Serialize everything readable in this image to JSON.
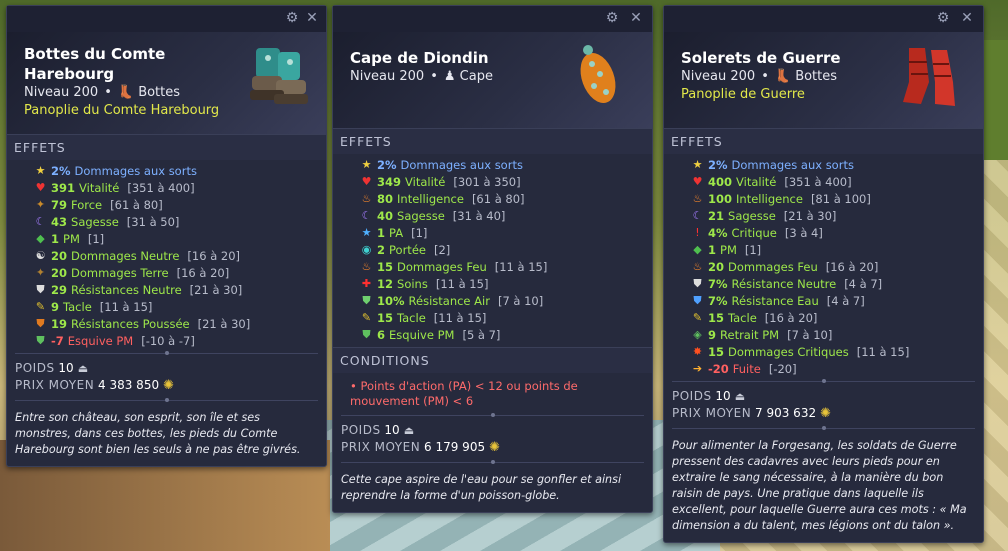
{
  "panels": [
    {
      "name": "Bottes du Comte Harebourg",
      "level": "Niveau 200",
      "type": "Bottes",
      "set": "Panoplie du Comte Harebourg",
      "effects_title": "EFFETS",
      "effects": [
        {
          "icon": "star-icon",
          "value": "2%",
          "label": "Dommages aux sorts",
          "range": "",
          "style": "blue"
        },
        {
          "icon": "heart-icon",
          "value": "391",
          "label": "Vitalité",
          "range": "[351 à 400]",
          "style": "green"
        },
        {
          "icon": "strength-icon",
          "value": "79",
          "label": "Force",
          "range": "[61 à 80]",
          "style": "green"
        },
        {
          "icon": "moon-icon",
          "value": "43",
          "label": "Sagesse",
          "range": "[31 à 50]",
          "style": "green"
        },
        {
          "icon": "pm-icon",
          "value": "1",
          "label": "PM",
          "range": "[1]",
          "style": "green"
        },
        {
          "icon": "neutral-icon",
          "value": "20",
          "label": "Dommages Neutre",
          "range": "[16 à 20]",
          "style": "green"
        },
        {
          "icon": "earth-icon",
          "value": "20",
          "label": "Dommages Terre",
          "range": "[16 à 20]",
          "style": "green"
        },
        {
          "icon": "shield-icon",
          "value": "29",
          "label": "Résistances Neutre",
          "range": "[21 à 30]",
          "style": "green"
        },
        {
          "icon": "tackle-icon",
          "value": "9",
          "label": "Tacle",
          "range": "[11 à 15]",
          "style": "green"
        },
        {
          "icon": "push-shield-icon",
          "value": "19",
          "label": "Résistances Poussée",
          "range": "[21 à 30]",
          "style": "green"
        },
        {
          "icon": "dodge-icon",
          "value": "-7",
          "label": "Esquive PM",
          "range": "[-10 à -7]",
          "style": "red"
        }
      ],
      "conditions": null,
      "weight_label": "POIDS",
      "weight": "10",
      "price_label": "PRIX MOYEN",
      "price": "4 383 850",
      "description": "Entre son château, son esprit, son île et ses monstres, dans ces bottes, les pieds du Comte Harebourg sont bien les seuls à ne pas être givrés."
    },
    {
      "name": "Cape de Diondin",
      "level": "Niveau 200",
      "type": "Cape",
      "set": "",
      "effects_title": "EFFETS",
      "effects": [
        {
          "icon": "star-icon",
          "value": "2%",
          "label": "Dommages aux sorts",
          "range": "",
          "style": "blue"
        },
        {
          "icon": "heart-icon",
          "value": "349",
          "label": "Vitalité",
          "range": "[301 à 350]",
          "style": "green"
        },
        {
          "icon": "fire-icon",
          "value": "80",
          "label": "Intelligence",
          "range": "[61 à 80]",
          "style": "green"
        },
        {
          "icon": "moon-icon",
          "value": "40",
          "label": "Sagesse",
          "range": "[31 à 40]",
          "style": "green"
        },
        {
          "icon": "pa-icon",
          "value": "1",
          "label": "PA",
          "range": "[1]",
          "style": "green"
        },
        {
          "icon": "range-icon",
          "value": "2",
          "label": "Portée",
          "range": "[2]",
          "style": "green"
        },
        {
          "icon": "fire-icon",
          "value": "15",
          "label": "Dommages Feu",
          "range": "[11 à 15]",
          "style": "green"
        },
        {
          "icon": "heal-icon",
          "value": "12",
          "label": "Soins",
          "range": "[11 à 15]",
          "style": "green"
        },
        {
          "icon": "shield-air-icon",
          "value": "10%",
          "label": "Résistance Air",
          "range": "[7 à 10]",
          "style": "green"
        },
        {
          "icon": "tackle-icon",
          "value": "15",
          "label": "Tacle",
          "range": "[11 à 15]",
          "style": "green"
        },
        {
          "icon": "dodge-icon",
          "value": "6",
          "label": "Esquive PM",
          "range": "[5 à 7]",
          "style": "green"
        }
      ],
      "conditions_title": "CONDITIONS",
      "conditions": "• Points d'action (PA) < 12 ou points de mouvement (PM) < 6",
      "weight_label": "POIDS",
      "weight": "10",
      "price_label": "PRIX MOYEN",
      "price": "6 179 905",
      "description": "Cette cape aspire de l'eau pour se gonfler et ainsi reprendre la forme d'un poisson-globe."
    },
    {
      "name": "Solerets de Guerre",
      "level": "Niveau 200",
      "type": "Bottes",
      "set": "Panoplie de Guerre",
      "effects_title": "EFFETS",
      "effects": [
        {
          "icon": "star-icon",
          "value": "2%",
          "label": "Dommages aux sorts",
          "range": "",
          "style": "blue"
        },
        {
          "icon": "heart-icon",
          "value": "400",
          "label": "Vitalité",
          "range": "[351 à 400]",
          "style": "green"
        },
        {
          "icon": "fire-icon",
          "value": "100",
          "label": "Intelligence",
          "range": "[81 à 100]",
          "style": "green"
        },
        {
          "icon": "moon-icon",
          "value": "21",
          "label": "Sagesse",
          "range": "[21 à 30]",
          "style": "green"
        },
        {
          "icon": "crit-icon",
          "value": "4%",
          "label": "Critique",
          "range": "[3 à 4]",
          "style": "green"
        },
        {
          "icon": "pm-icon",
          "value": "1",
          "label": "PM",
          "range": "[1]",
          "style": "green"
        },
        {
          "icon": "fire-icon",
          "value": "20",
          "label": "Dommages Feu",
          "range": "[16 à 20]",
          "style": "green"
        },
        {
          "icon": "shield-icon",
          "value": "7%",
          "label": "Résistance Neutre",
          "range": "[4 à 7]",
          "style": "green"
        },
        {
          "icon": "shield-water-icon",
          "value": "7%",
          "label": "Résistance Eau",
          "range": "[4 à 7]",
          "style": "green"
        },
        {
          "icon": "tackle-icon",
          "value": "15",
          "label": "Tacle",
          "range": "[16 à 20]",
          "style": "green"
        },
        {
          "icon": "retreat-icon",
          "value": "9",
          "label": "Retrait PM",
          "range": "[7 à 10]",
          "style": "green"
        },
        {
          "icon": "crit-dmg-icon",
          "value": "15",
          "label": "Dommages Critiques",
          "range": "[11 à 15]",
          "style": "green"
        },
        {
          "icon": "flee-icon",
          "value": "-20",
          "label": "Fuite",
          "range": "[-20]",
          "style": "red"
        }
      ],
      "conditions": null,
      "weight_label": "POIDS",
      "weight": "10",
      "price_label": "PRIX MOYEN",
      "price": "7 903 632",
      "description": "Pour alimenter la Forgesang, les soldats de Guerre pressent des cadavres avec leurs pieds pour en extraire le sang nécessaire, à la manière du bon raisin de pays. Une pratique dans laquelle ils excellent, pour laquelle Guerre aura ces mots : « Ma dimension a du talent, mes légions ont du talon »."
    }
  ]
}
